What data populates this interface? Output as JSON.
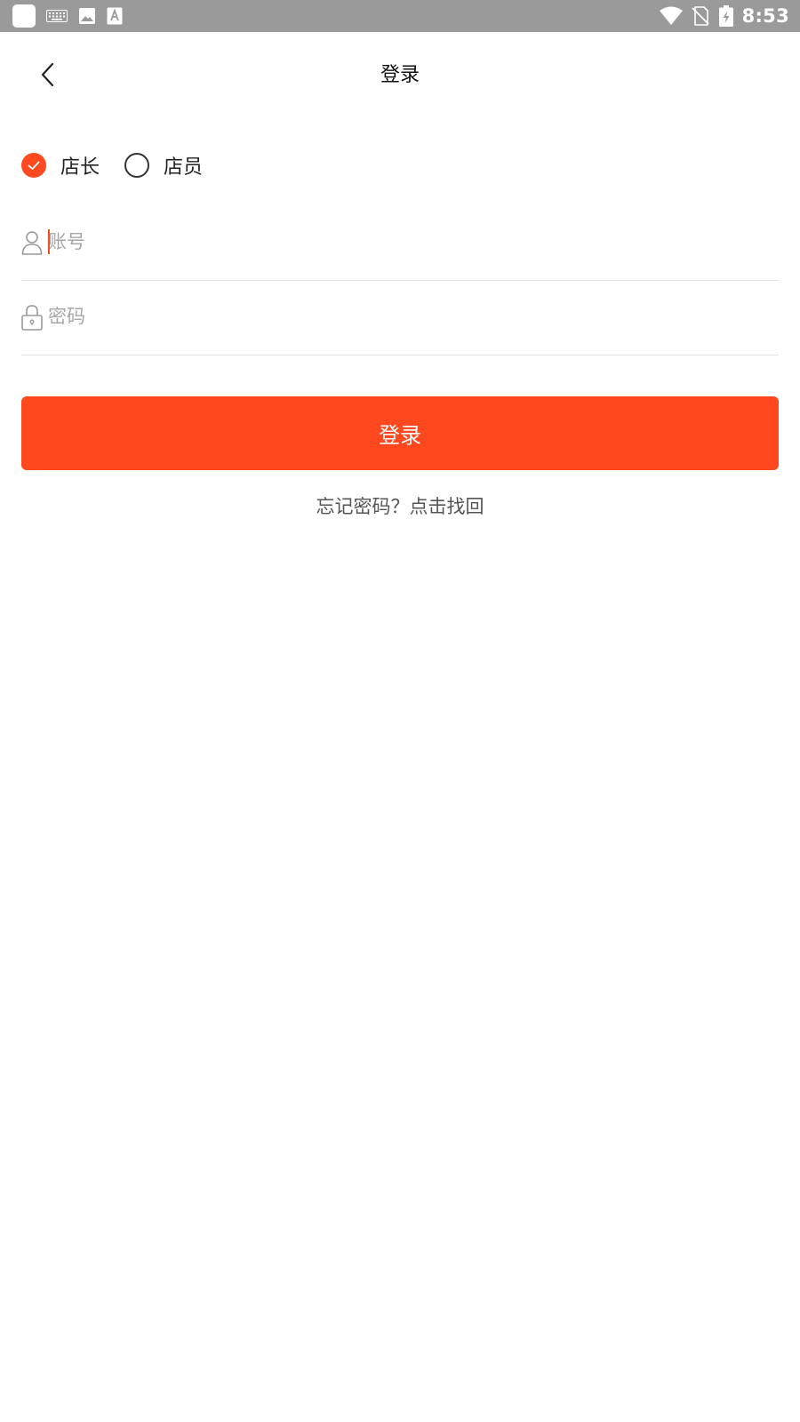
{
  "status_bar": {
    "time": "8:53",
    "icons": [
      "app-square-icon",
      "keyboard-icon",
      "image-icon",
      "text-a-icon",
      "wifi-icon",
      "no-sim-icon",
      "battery-charging-icon"
    ]
  },
  "header": {
    "title": "登录",
    "back_icon": "chevron-left-icon"
  },
  "roles": {
    "options": [
      {
        "label": "店长",
        "selected": true
      },
      {
        "label": "店员",
        "selected": false
      }
    ]
  },
  "form": {
    "account": {
      "placeholder": "账号",
      "value": "",
      "icon": "user-icon"
    },
    "password": {
      "placeholder": "密码",
      "value": "",
      "icon": "lock-icon"
    }
  },
  "login_button": {
    "label": "登录"
  },
  "forgot_link": {
    "label": "忘记密码？点击找回"
  },
  "colors": {
    "accent": "#ff481e",
    "status_bar": "#9a9a9a"
  }
}
